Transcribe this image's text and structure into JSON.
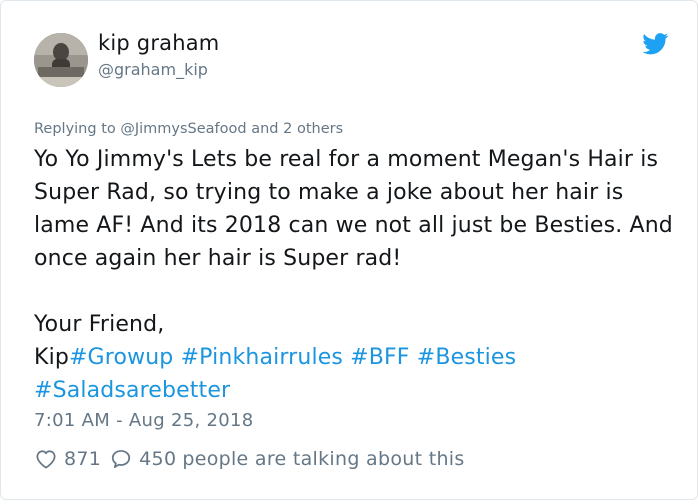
{
  "tweet": {
    "author_name": "kip graham",
    "author_handle": "@graham_kip",
    "reply_prefix": "Replying to ",
    "reply_to": "@JimmysSeafood",
    "reply_suffix": " and 2 others",
    "paragraph1": "Yo Yo Jimmy's Lets be real for a moment Megan's Hair is Super Rad, so trying to make a joke about her hair is lame AF! And its 2018 can we not all just be Besties. And once again her hair is Super rad!",
    "sign_off": "Your Friend,",
    "signature": "Kip",
    "hashtags": [
      "#Growup",
      "#Pinkhairrules",
      "#BFF",
      "#Besties",
      "#Saladsarebetter"
    ],
    "timestamp": "7:01 AM - Aug 25, 2018",
    "like_count": "871",
    "reply_count": "450",
    "talking_text": "people are talking about this"
  },
  "colors": {
    "link": "#1b95e0",
    "muted": "#657786",
    "text": "#14171a",
    "twitter_bird": "#1da1f2"
  },
  "icons": {
    "brand": "twitter-bird-icon",
    "like": "heart-icon",
    "reply": "speech-bubble-icon"
  }
}
